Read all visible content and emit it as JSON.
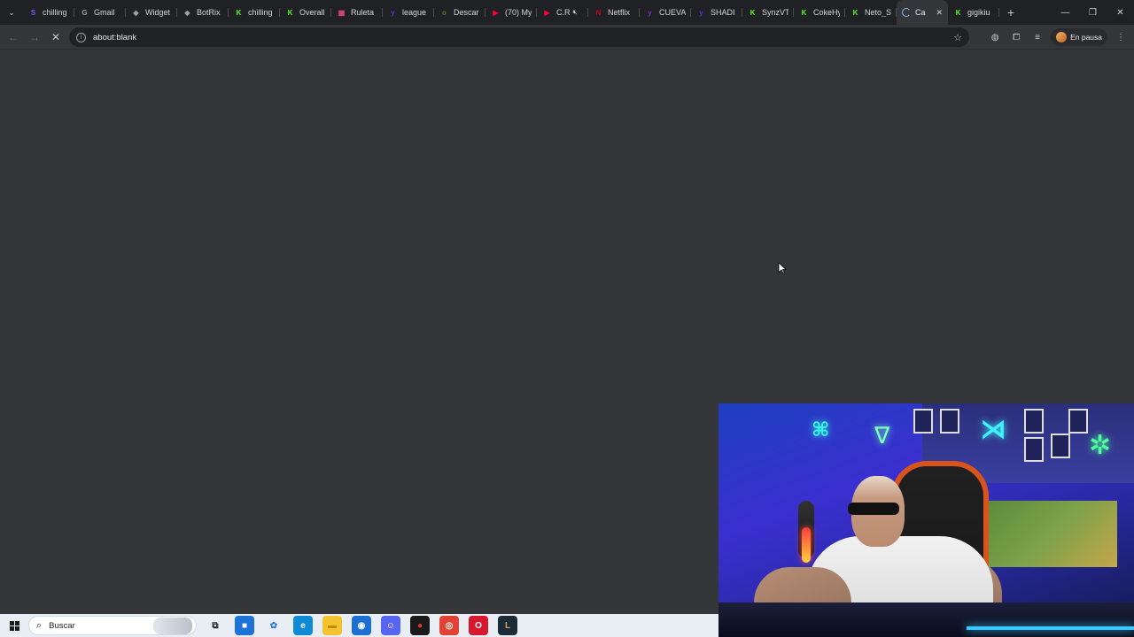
{
  "browser": {
    "tabs": [
      {
        "label": "chilling",
        "favicon": "kick-icon",
        "color": "#7d55ff",
        "glyph": "S"
      },
      {
        "label": "Gmail",
        "favicon": "google-icon",
        "color": "#9aa0a6",
        "glyph": "G"
      },
      {
        "label": "Widget",
        "favicon": "botrix-icon",
        "color": "#9aa0a6",
        "glyph": "◆"
      },
      {
        "label": "BotRix",
        "favicon": "botrix-icon",
        "color": "#9aa0a6",
        "glyph": "◆"
      },
      {
        "label": "chilling",
        "favicon": "kick-icon",
        "color": "#53fc18",
        "glyph": "K"
      },
      {
        "label": "Overall",
        "favicon": "kick-icon",
        "color": "#53fc18",
        "glyph": "K"
      },
      {
        "label": "Ruleta",
        "favicon": "wheel-icon",
        "color": "#e04a7a",
        "glyph": "▦"
      },
      {
        "label": "league",
        "favicon": "yahoo-icon",
        "color": "#6c2bd9",
        "glyph": "y"
      },
      {
        "label": "Descar",
        "favicon": "download-icon",
        "color": "#6b6b2a",
        "glyph": "o"
      },
      {
        "label": "(70) My",
        "favicon": "youtube-icon",
        "color": "#ff0033",
        "glyph": "▶"
      },
      {
        "label": "C.R",
        "favicon": "youtube-icon",
        "color": "#ff0033",
        "glyph": "▶",
        "muted": true
      },
      {
        "label": "Netflix",
        "favicon": "netflix-icon",
        "color": "#c3001b",
        "glyph": "N"
      },
      {
        "label": "CUEVA",
        "favicon": "yahoo-icon",
        "color": "#6c2bd9",
        "glyph": "y"
      },
      {
        "label": "SHADI",
        "favicon": "yahoo-icon",
        "color": "#6c2bd9",
        "glyph": "y"
      },
      {
        "label": "SynzVT",
        "favicon": "kick-icon",
        "color": "#53fc18",
        "glyph": "K"
      },
      {
        "label": "CokeHy",
        "favicon": "kick-icon",
        "color": "#53fc18",
        "glyph": "K"
      },
      {
        "label": "Neto_S",
        "favicon": "kick-icon",
        "color": "#53fc18",
        "glyph": "K"
      },
      {
        "label": "Ca",
        "favicon": "loading-spinner-icon",
        "active": true
      },
      {
        "label": "gigikiu",
        "favicon": "kick-icon",
        "color": "#53fc18",
        "glyph": "K"
      }
    ],
    "url": "about:blank",
    "profile_label": "En pausa",
    "accent": "#8ab4f8"
  },
  "taskbar": {
    "search_placeholder": "Buscar",
    "apps": [
      {
        "name": "task-view-icon",
        "glyph": "⧉",
        "bg": "transparent",
        "fg": "#222"
      },
      {
        "name": "store-icon",
        "glyph": "■",
        "bg": "#1e73d8",
        "fg": "#fff"
      },
      {
        "name": "copilot-icon",
        "glyph": "✿",
        "bg": "transparent",
        "fg": "#2f7ae5"
      },
      {
        "name": "edge-icon",
        "glyph": "e",
        "bg": "#0f8bd6",
        "fg": "#fff"
      },
      {
        "name": "file-explorer-icon",
        "glyph": "▬",
        "bg": "#f4c430",
        "fg": "#c48a00"
      },
      {
        "name": "outlook-icon",
        "glyph": "◉",
        "bg": "#1d6fd1",
        "fg": "#fff"
      },
      {
        "name": "discord-icon",
        "glyph": "☺",
        "bg": "#5865f2",
        "fg": "#fff"
      },
      {
        "name": "app-red-black-icon",
        "glyph": "●",
        "bg": "#1a1a1a",
        "fg": "#e53935"
      },
      {
        "name": "chrome-icon",
        "glyph": "◎",
        "bg": "#e34133",
        "fg": "#fff"
      },
      {
        "name": "opera-icon",
        "glyph": "O",
        "bg": "#d8172d",
        "fg": "#fff"
      },
      {
        "name": "league-icon",
        "glyph": "L",
        "bg": "#1c2a3a",
        "fg": "#c8a74a"
      }
    ]
  }
}
